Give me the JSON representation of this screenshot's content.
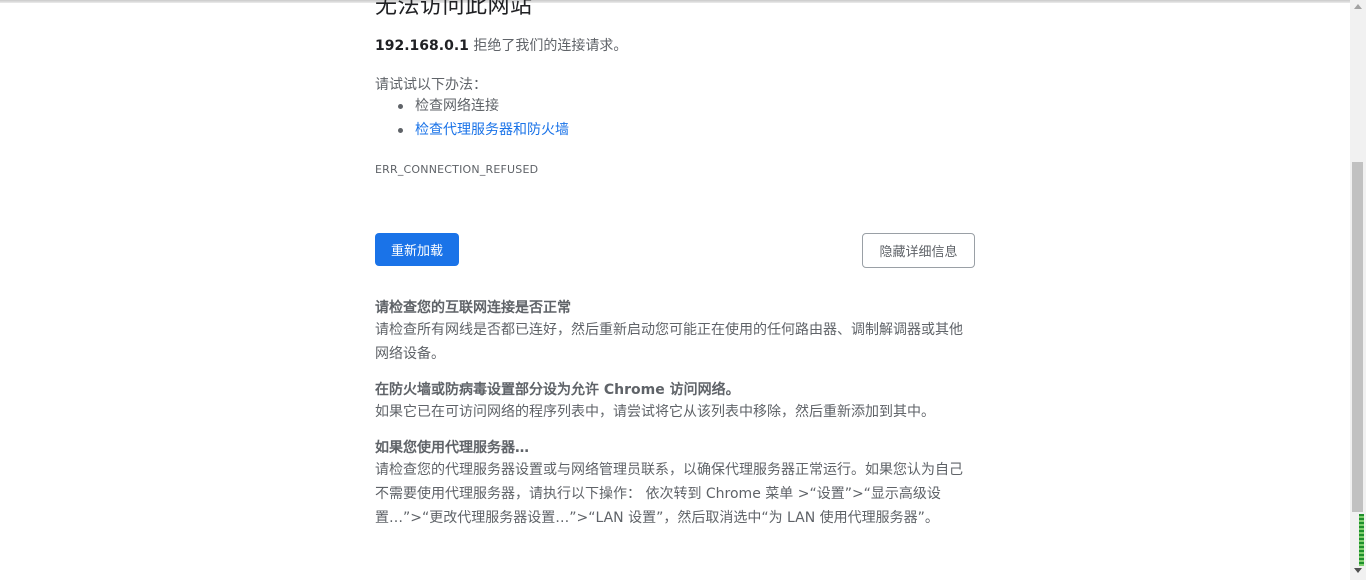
{
  "error_page": {
    "title": "无法访问此网站",
    "host": "192.168.0.1",
    "refused_text": " 拒绝了我们的连接请求。",
    "try_header": "请试试以下办法：",
    "suggestions": [
      {
        "label": "检查网络连接",
        "is_link": false
      },
      {
        "label": "检查代理服务器和防火墙",
        "is_link": true
      }
    ],
    "error_code": "ERR_CONNECTION_REFUSED",
    "reload_label": "重新加载",
    "details_label": "隐藏详细信息"
  },
  "details": [
    {
      "heading": "请检查您的互联网连接是否正常",
      "body": "请检查所有网线是否都已连好，然后重新启动您可能正在使用的任何路由器、调制解调器或其他网络设备。"
    },
    {
      "heading": "在防火墙或防病毒设置部分设为允许 Chrome 访问网络。",
      "body": "如果它已在可访问网络的程序列表中，请尝试将它从该列表中移除，然后重新添加到其中。"
    },
    {
      "heading": "如果您使用代理服务器…",
      "body": "请检查您的代理服务器设置或与网络管理员联系，以确保代理服务器正常运行。如果您认为自己不需要使用代理服务器，请执行以下操作： 依次转到 Chrome 菜单 >“设置”>“显示高级设置…”>“更改代理服务器设置…”>“LAN 设置”，然后取消选中“为 LAN 使用代理服务器”。"
    }
  ],
  "colors": {
    "accent": "#1a73e8",
    "text": "#5f6368",
    "title": "#202124"
  }
}
